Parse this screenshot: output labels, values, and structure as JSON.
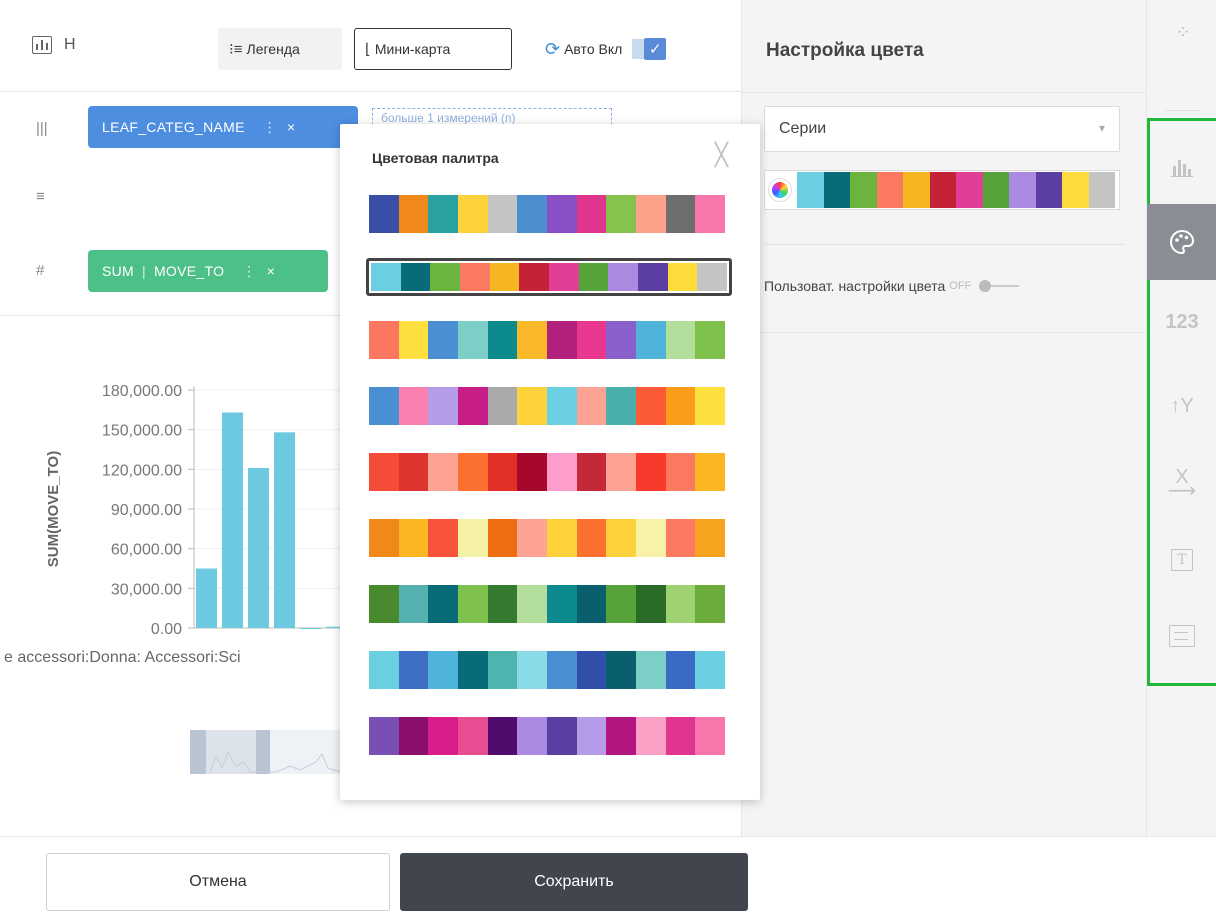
{
  "toolbar": {
    "title": "Н",
    "legend_icon": "legend-icon",
    "legend_label": "Легенда",
    "minimap_icon": "minimap-icon",
    "minimap_label": "Мини-карта",
    "auto_icon": "refresh-icon",
    "auto_label": "Авто Вкл",
    "auto_checked": true
  },
  "shelves": {
    "dimension_pill": "LEAF_CATEG_NAME",
    "dimension_drop_hint": "больше 1 измерений (п)",
    "measure_agg": "SUM",
    "measure_field": "MOVE_TO"
  },
  "chart": {
    "ylabel": "SUM(MOVE_TO)",
    "y_ticks": [
      "180,000.00",
      "150,000.00",
      "120,000.00",
      "90,000.00",
      "60,000.00",
      "30,000.00",
      "0.00"
    ],
    "x_label_text": "e accessori:Donna: Accessori:Sci"
  },
  "chart_data": {
    "type": "bar",
    "values": [
      45000,
      163000,
      121000,
      148000,
      0,
      1000
    ],
    "ylim": [
      0,
      180000
    ],
    "ylabel": "SUM(MOVE_TO)",
    "grid": true,
    "color": "#6cc9e0"
  },
  "settings": {
    "title": "Настройка цвета",
    "series_select": "Серии",
    "custom_color_label": "Пользоват. настройки цвета",
    "custom_color_state": "OFF"
  },
  "popup": {
    "title": "Цветовая палитра",
    "selected_index": 1,
    "palettes": [
      [
        "#3a4ea8",
        "#f0891a",
        "#2aa2a2",
        "#fdd23a",
        "#c4c4c4",
        "#4b8fcf",
        "#8a4fc4",
        "#e0358f",
        "#86c24e",
        "#fba28a",
        "#6e6e6e",
        "#f777ac"
      ],
      [
        "#6bcfe2",
        "#0a6b78",
        "#6bb43f",
        "#fb7a5f",
        "#f6b621",
        "#c42337",
        "#e13f95",
        "#56a33a",
        "#a98ae0",
        "#5b3ea2",
        "#fbdc3a",
        "#c4c4c4"
      ],
      [
        "#fb7760",
        "#fde03e",
        "#4a8fd1",
        "#7bcfc6",
        "#0d8a8e",
        "#f8b828",
        "#b0207c",
        "#e8378f",
        "#8a61cc",
        "#4fb4d9",
        "#b2dd9a",
        "#7dc04c"
      ],
      [
        "#4a8fd1",
        "#fb7fb0",
        "#b69ce8",
        "#c71d86",
        "#aaaaaa",
        "#fdd23a",
        "#6bcfe2",
        "#fca394",
        "#4aafaa",
        "#fb5a37",
        "#fc9c1b",
        "#fde03e"
      ],
      [
        "#f64b39",
        "#dd342f",
        "#fca394",
        "#fb6f2f",
        "#e23027",
        "#a6082c",
        "#fc9ec9",
        "#c52836",
        "#fca394",
        "#f73a2c",
        "#fb7a5f",
        "#fbb621"
      ],
      [
        "#f0891a",
        "#fbb621",
        "#f7533a",
        "#f6f2a5",
        "#ef6d12",
        "#fca394",
        "#fdd23a",
        "#fb6f2f",
        "#fdd23a",
        "#f7f2a8",
        "#fb7a5f",
        "#f6a31f"
      ],
      [
        "#4a8a2f",
        "#55b1ad",
        "#0a6b78",
        "#7dc04c",
        "#357a2f",
        "#b2dd9a",
        "#0d8a8e",
        "#0a5f6c",
        "#56a33a",
        "#2a6b27",
        "#9ed16f",
        "#6aab3c"
      ],
      [
        "#6bcfe2",
        "#3e6fc4",
        "#4fb4d9",
        "#0a6b78",
        "#4fb4ad",
        "#8adbe8",
        "#4a8fd1",
        "#2f4fa8",
        "#0a5f6c",
        "#7bcfc6",
        "#3a6bc4",
        "#6bcfe2"
      ],
      [
        "#7a4fb4",
        "#8c0f6b",
        "#d91d8a",
        "#e84c91",
        "#4f0b6b",
        "#a98ae0",
        "#5b3ea2",
        "#b69ce8",
        "#b3157f",
        "#f9a0c4",
        "#e0358f",
        "#f777ac"
      ]
    ]
  },
  "current_palette": [
    "#6bcfe2",
    "#0a6b78",
    "#6bb43f",
    "#fb7a5f",
    "#f6b621",
    "#c42337",
    "#e13f95",
    "#56a33a",
    "#a98ae0",
    "#5b3ea2",
    "#fbdc3a",
    "#c4c4c4"
  ],
  "rail": {
    "top_icon": "drilldown-icon",
    "items": [
      "chart-type-icon",
      "palette-icon",
      "number-format-icon",
      "y-axis-icon",
      "x-axis-icon",
      "text-icon",
      "comment-icon"
    ],
    "number_label": "123",
    "active_index": 1,
    "frame_color": "#22b83a"
  },
  "footer": {
    "cancel_label": "Отмена",
    "save_label": "Сохранить"
  }
}
